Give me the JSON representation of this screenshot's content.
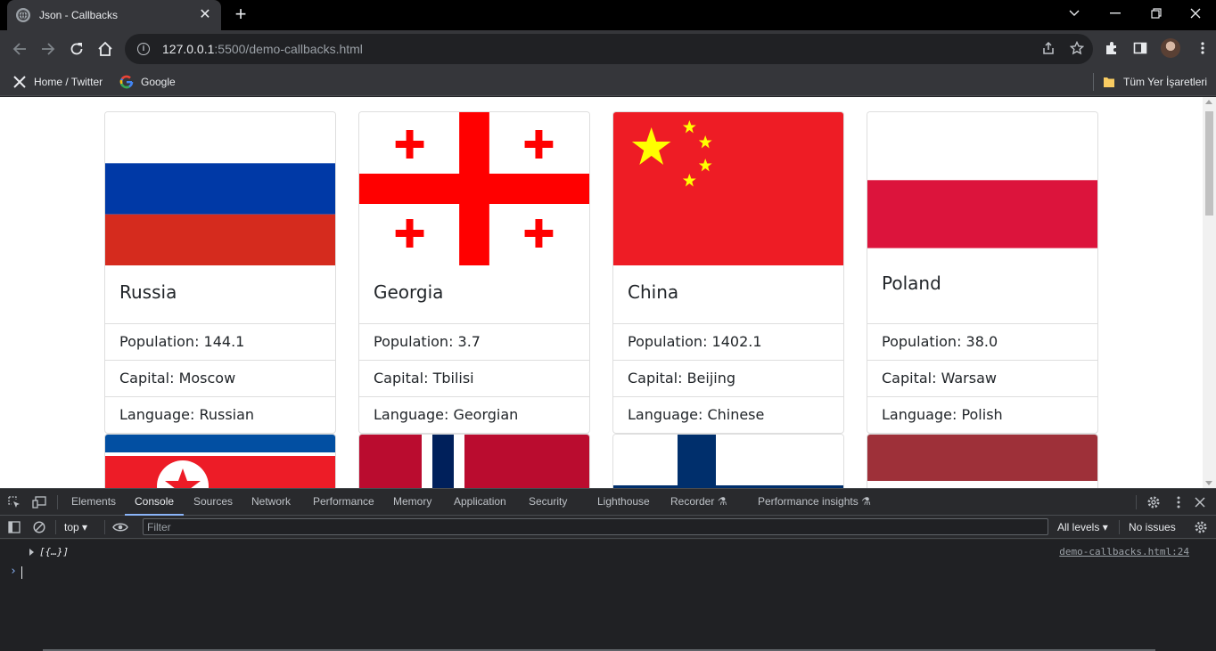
{
  "browser": {
    "tab_title": "Json - Callbacks",
    "url_host": "127.0.0.1",
    "url_rest": ":5500/demo-callbacks.html",
    "bookmarks": [
      {
        "label": "Home / Twitter",
        "icon": "x-logo-icon"
      },
      {
        "label": "Google",
        "icon": "google-logo-icon"
      }
    ],
    "all_bookmarks_label": "Tüm Yer İşaretleri"
  },
  "countries": [
    {
      "name": "Russia",
      "population": "Population: 144.1",
      "capital": "Capital: Moscow",
      "language": "Language: Russian"
    },
    {
      "name": "Georgia",
      "population": "Population: 3.7",
      "capital": "Capital: Tbilisi",
      "language": "Language: Georgian"
    },
    {
      "name": "China",
      "population": "Population: 1402.1",
      "capital": "Capital: Beijing",
      "language": "Language: Chinese"
    },
    {
      "name": "Poland",
      "population": "Population: 38.0",
      "capital": "Capital: Warsaw",
      "language": "Language: Polish"
    }
  ],
  "devtools": {
    "tabs": [
      "Elements",
      "Console",
      "Sources",
      "Network",
      "Performance",
      "Memory",
      "Application",
      "Security",
      "Lighthouse",
      "Recorder",
      "Performance insights"
    ],
    "active_tab": "Console",
    "context": "top",
    "filter_placeholder": "Filter",
    "levels": "All levels",
    "issues": "No issues",
    "log_text": "[{…}]",
    "log_source": "demo-callbacks.html:24"
  },
  "colors": {
    "flag_red": "#da291c",
    "russia_blue": "#0039a6",
    "georgia_red": "#ff0000",
    "china_red": "#ee1c25",
    "china_yellow": "#ffff00",
    "poland_red": "#dc143c",
    "accent": "#8ab4f8"
  }
}
